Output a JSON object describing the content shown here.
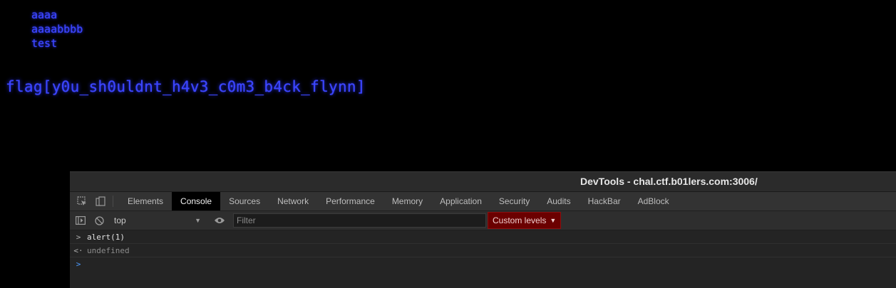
{
  "page": {
    "list_items": [
      "aaaa",
      "aaaabbbb",
      "test"
    ],
    "flag_text": "flag[y0u_sh0uldnt_h4v3_c0m3_b4ck_flynn]"
  },
  "devtools": {
    "title": "DevTools - chal.ctf.b01lers.com:3006/",
    "toolbar_icons": [
      "inspect-element-icon",
      "device-toggle-icon"
    ],
    "tabs": [
      {
        "label": "Elements",
        "active": false
      },
      {
        "label": "Console",
        "active": true
      },
      {
        "label": "Sources",
        "active": false
      },
      {
        "label": "Network",
        "active": false
      },
      {
        "label": "Performance",
        "active": false
      },
      {
        "label": "Memory",
        "active": false
      },
      {
        "label": "Application",
        "active": false
      },
      {
        "label": "Security",
        "active": false
      },
      {
        "label": "Audits",
        "active": false
      },
      {
        "label": "HackBar",
        "active": false
      },
      {
        "label": "AdBlock",
        "active": false
      }
    ],
    "console_toolbar": {
      "context": "top",
      "filter_placeholder": "Filter",
      "levels_label": "Custom levels"
    },
    "console": {
      "entries": [
        {
          "type": "input",
          "glyph": ">",
          "text": "alert(1)"
        },
        {
          "type": "result",
          "glyph": "<·",
          "text": "undefined"
        }
      ],
      "prompt_glyph": ">"
    }
  },
  "colors": {
    "page_text": "#3b45ff",
    "devtools_bg": "#242424",
    "levels_bg": "#6b0000"
  }
}
